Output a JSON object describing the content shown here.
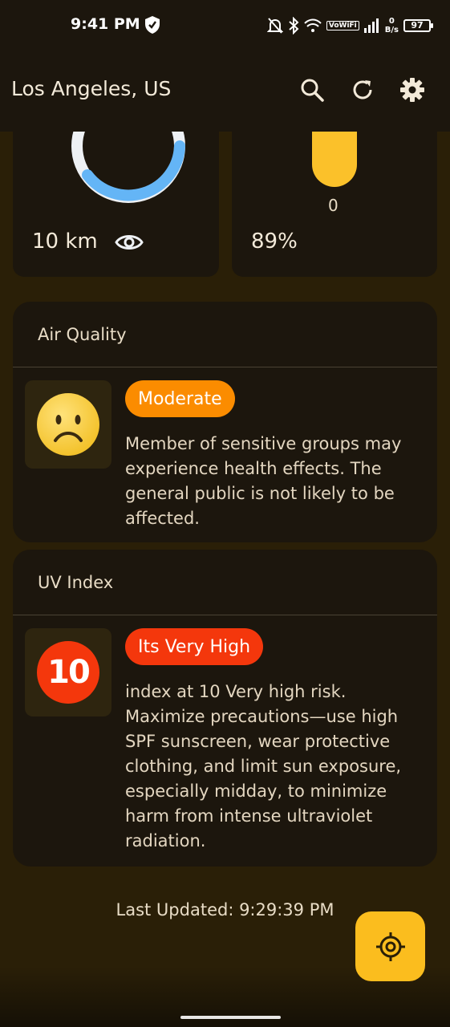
{
  "status_bar": {
    "time": "9:41 PM",
    "vowifi": "VoWiFi",
    "net_speed_value": "0",
    "net_speed_unit": "B/s",
    "battery": "97"
  },
  "app_bar": {
    "title": "Los Angeles, US",
    "icons": [
      "search-icon",
      "refresh-icon",
      "gear-icon"
    ]
  },
  "top_cards": {
    "visibility_value": "10 km",
    "visibility_gauge_fraction": 0.8,
    "humidity_bar_label": "0",
    "humidity_value": "89%"
  },
  "air_quality": {
    "title": "Air Quality",
    "badge": "Moderate",
    "badge_color": "#fb8c00",
    "icon": "sad-face-icon",
    "description": "Member of sensitive groups may experience health effects. The general public is not likely to be affected."
  },
  "uv_index": {
    "title": "UV Index",
    "value": "10",
    "badge": "Its Very High",
    "badge_color": "#f4370c",
    "description": "index at 10 Very high risk. Maximize precautions—use high SPF sunscreen, wear protective clothing, and limit sun exposure, especially midday, to minimize harm from intense ultraviolet radiation."
  },
  "footer": {
    "last_updated": "Last Updated: 9:29:39 PM",
    "fab_icon": "locate-icon"
  },
  "colors": {
    "accent": "#fbbd1e",
    "background": "#2a1f07",
    "card": "#1c160d"
  }
}
